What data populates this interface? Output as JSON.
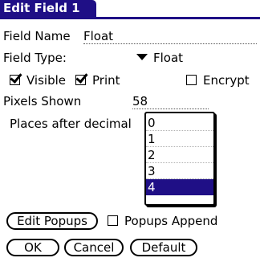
{
  "dialog": {
    "title": "Edit Field 1"
  },
  "field_name": {
    "label": "Field Name",
    "value": "Float"
  },
  "field_type": {
    "label": "Field Type:",
    "value": "Float"
  },
  "checkboxes": {
    "visible": {
      "label": "Visible",
      "checked": true
    },
    "print": {
      "label": "Print",
      "checked": true
    },
    "encrypt": {
      "label": "Encrypt",
      "checked": false
    }
  },
  "pixels_shown": {
    "label": "Pixels Shown",
    "value": "58"
  },
  "places_after_decimal": {
    "label": "Places after decimal",
    "options": [
      "0",
      "1",
      "2",
      "3",
      "4"
    ],
    "selected": "4"
  },
  "edit_popups_button": "Edit Popups",
  "popups_append": {
    "label": "Popups Append",
    "checked": false
  },
  "buttons": {
    "ok": "OK",
    "cancel": "Cancel",
    "default": "Default"
  },
  "colors": {
    "accent": "#1f0f86",
    "background": "#ffffff"
  }
}
